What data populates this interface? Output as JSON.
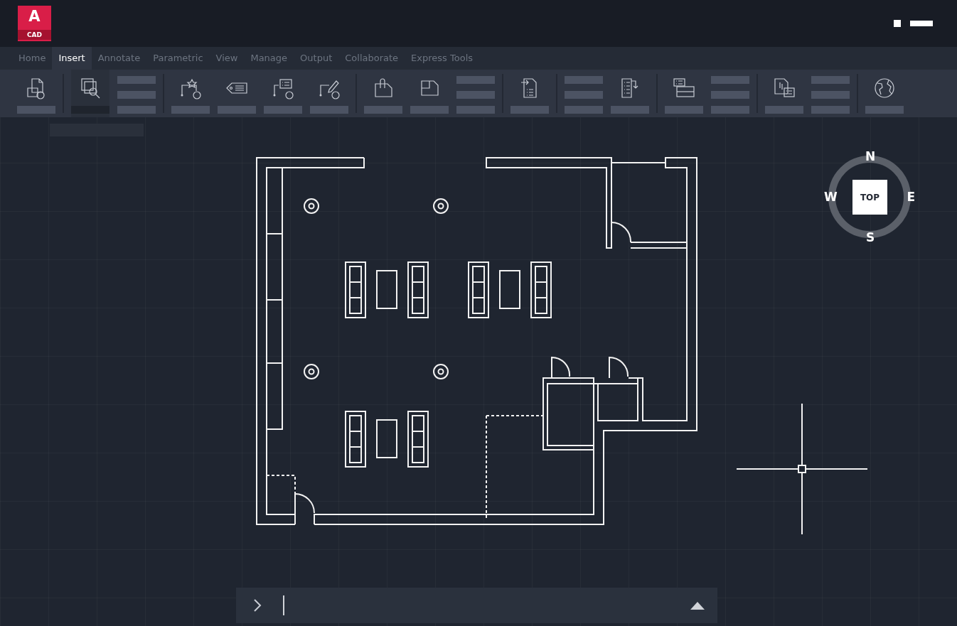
{
  "logo": {
    "letter": "A",
    "label": "CAD"
  },
  "tabs": [
    {
      "label": "Home",
      "selected": false
    },
    {
      "label": "Insert",
      "selected": true
    },
    {
      "label": "Annotate",
      "selected": false
    },
    {
      "label": "Parametric",
      "selected": false
    },
    {
      "label": "View",
      "selected": false
    },
    {
      "label": "Manage",
      "selected": false
    },
    {
      "label": "Output",
      "selected": false
    },
    {
      "label": "Collaborate",
      "selected": false
    },
    {
      "label": "Express Tools",
      "selected": false
    }
  ],
  "ribbon": [
    {
      "tools": [
        {
          "kind": "large",
          "selected": false
        }
      ]
    },
    {
      "tools": [
        {
          "kind": "large",
          "selected": true
        },
        {
          "kind": "stack"
        }
      ]
    },
    {
      "tools": [
        {
          "kind": "large",
          "selected": false
        },
        {
          "kind": "large",
          "selected": false
        },
        {
          "kind": "large",
          "selected": false
        },
        {
          "kind": "large",
          "selected": false
        }
      ]
    },
    {
      "tools": [
        {
          "kind": "large",
          "selected": false
        },
        {
          "kind": "large",
          "selected": false
        },
        {
          "kind": "stack"
        }
      ]
    },
    {
      "tools": [
        {
          "kind": "large",
          "selected": false
        }
      ]
    },
    {
      "tools": [
        {
          "kind": "stack"
        },
        {
          "kind": "large",
          "selected": false
        }
      ]
    },
    {
      "tools": [
        {
          "kind": "large",
          "selected": false
        },
        {
          "kind": "stack"
        }
      ]
    },
    {
      "tools": [
        {
          "kind": "large",
          "selected": false
        },
        {
          "kind": "stack"
        }
      ]
    },
    {
      "tools": [
        {
          "kind": "large",
          "selected": false
        }
      ]
    }
  ],
  "viewcube": {
    "face": "TOP",
    "north": "N",
    "south": "S",
    "east": "E",
    "west": "W"
  },
  "command_line": {
    "focused": true
  }
}
